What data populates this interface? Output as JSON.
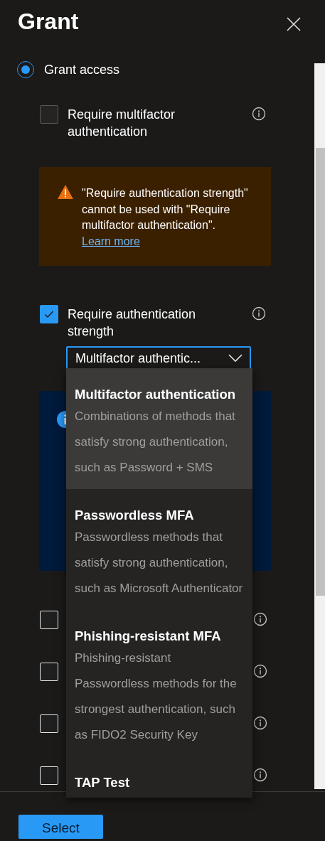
{
  "panel": {
    "title": "Grant"
  },
  "grant_option": {
    "label": "Grant access",
    "selected": true
  },
  "mfa_control": {
    "label": "Require multifactor authentication",
    "checked": false
  },
  "warning": {
    "text": "\"Require authentication strength\" cannot be used with \"Require multifactor authentication\".",
    "link": "Learn more"
  },
  "strength_control": {
    "label": "Require authentication strength",
    "checked": true,
    "value": "Multifactor authentic..."
  },
  "hidden_controls": [
    {
      "checked": false
    },
    {
      "checked": false
    },
    {
      "checked": false
    },
    {
      "checked": false
    }
  ],
  "dropdown_options": [
    {
      "title": "Multifactor authentication",
      "description": "Combinations of methods that satisfy strong authentication, such as Password + SMS",
      "selected": true
    },
    {
      "title": "Passwordless MFA",
      "description": "Passwordless methods that satisfy strong authentication, such as Microsoft Authenticator",
      "selected": false
    },
    {
      "title": "Phishing-resistant MFA",
      "description": "Phishing-resistant Passwordless methods for the strongest authentication, such as FIDO2 Security Key",
      "selected": false
    },
    {
      "title": "TAP Test",
      "selected": false
    }
  ],
  "footer": {
    "button": "Select"
  }
}
